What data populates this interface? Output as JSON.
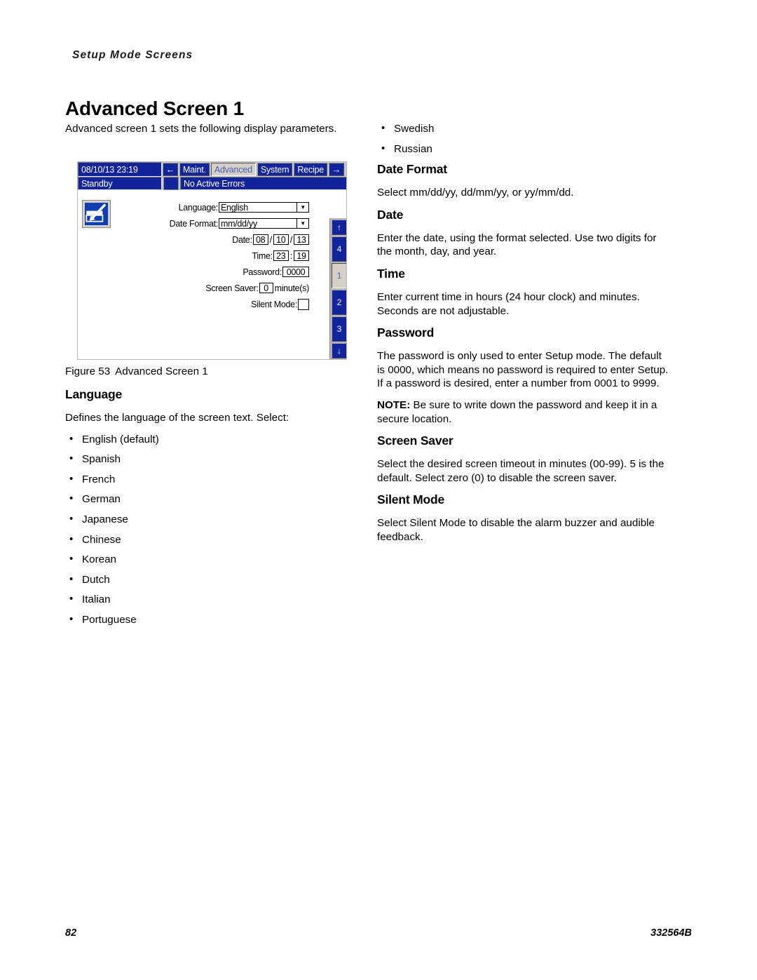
{
  "running_header": "Setup Mode Screens",
  "chapter_title": "Advanced Screen 1",
  "intro": "Advanced screen 1 sets the following display parameters.",
  "figure": {
    "caption_label": "Figure 53",
    "caption_text": "Advanced Screen 1",
    "hmi": {
      "datetime": "08/10/13 23:19",
      "prev_arrow": "←",
      "next_arrow": "→",
      "tabs": [
        {
          "label": "Maint.",
          "active": false
        },
        {
          "label": "Advanced",
          "active": true
        },
        {
          "label": "System",
          "active": false
        },
        {
          "label": "Recipe",
          "active": false
        }
      ],
      "status_mode": "Standby",
      "status_errors": "No Active Errors",
      "setup_icon_name": "setup-edit-icon",
      "fields": {
        "language_label": "Language:",
        "language_value": "English",
        "date_format_label": "Date Format:",
        "date_format_value": "mm/dd/yy",
        "date_label": "Date:",
        "date_month": "08",
        "date_day": "10",
        "date_year": "13",
        "date_sep": "/",
        "time_label": "Time:",
        "time_hours": "23",
        "time_minutes": "19",
        "time_sep": ":",
        "password_label": "Password:",
        "password_value": "0000",
        "screen_saver_label": "Screen Saver:",
        "screen_saver_value": "0",
        "screen_saver_units": "minute(s)",
        "silent_mode_label": "Silent Mode:",
        "silent_mode_checked": false
      },
      "rail": [
        {
          "label": "↑",
          "kind": "up-arrow",
          "selected": false
        },
        {
          "label": "4",
          "kind": "screen-4",
          "selected": false
        },
        {
          "label": "1",
          "kind": "screen-1",
          "selected": true
        },
        {
          "label": "2",
          "kind": "screen-2",
          "selected": false
        },
        {
          "label": "3",
          "kind": "screen-3",
          "selected": false
        },
        {
          "label": "↓",
          "kind": "down-arrow",
          "selected": false
        }
      ]
    }
  },
  "sections": {
    "language": {
      "heading": "Language",
      "body": "Defines the language of the screen text. Select:",
      "options_left": [
        "English (default)",
        "Spanish",
        "French",
        "German",
        "Japanese",
        "Chinese",
        "Korean",
        "Dutch",
        "Italian",
        "Portuguese"
      ],
      "options_right": [
        "Swedish",
        "Russian"
      ]
    },
    "date_format": {
      "heading": "Date Format",
      "body": "Select mm/dd/yy, dd/mm/yy, or yy/mm/dd."
    },
    "date": {
      "heading": "Date",
      "body": "Enter the date, using the format selected. Use two digits for the month, day, and year."
    },
    "time": {
      "heading": "Time",
      "body": "Enter current time in hours (24 hour clock) and minutes. Seconds are not adjustable."
    },
    "password": {
      "heading": "Password",
      "body": "The password is only used to enter Setup mode. The default is 0000, which means no password is required to enter Setup. If a password is desired, enter a number from 0001 to 9999.",
      "note_label": "NOTE:",
      "note_body": "Be sure to write down the password and keep it in a secure location."
    },
    "screen_saver": {
      "heading": "Screen Saver",
      "body": "Select the desired screen timeout in minutes (00-99). 5 is the default. Select zero (0) to disable the screen saver."
    },
    "silent_mode": {
      "heading": "Silent Mode",
      "body": "Select Silent Mode to disable the alarm buzzer and audible feedback."
    }
  },
  "footer": {
    "page_number": "82",
    "doc_number": "332564B"
  },
  "colors": {
    "hmi_blue": "#12249c",
    "hmi_selected_tab_bg": "#d4d0c8",
    "hmi_selected_tab_text": "#4a5fb8",
    "icon_blue": "#0c3fb5"
  }
}
